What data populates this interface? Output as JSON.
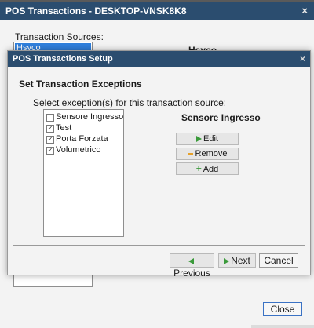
{
  "outer_window": {
    "title": "POS Transactions - DESKTOP-VNSK8K8",
    "close_glyph": "×",
    "sources_label": "Transaction Sources:",
    "sources": [
      "Hsyco"
    ],
    "selected_source_name": "Hsyco",
    "close_button": "Close"
  },
  "dialog": {
    "title": "POS Transactions Setup",
    "close_glyph": "×",
    "heading": "Set Transaction Exceptions",
    "prompt": "Select exception(s) for this transaction source:",
    "exceptions": [
      {
        "label": "Sensore Ingresso",
        "checked": false
      },
      {
        "label": "Test",
        "checked": true
      },
      {
        "label": "Porta Forzata",
        "checked": true
      },
      {
        "label": "Volumetrico",
        "checked": true
      }
    ],
    "selected_exception_name": "Sensore Ingresso",
    "buttons": {
      "edit": "Edit",
      "remove": "Remove",
      "add": "Add",
      "previous": "Previous",
      "next": "Next",
      "cancel": "Cancel"
    }
  },
  "colors": {
    "title_bar": "#2b4d6f",
    "selection": "#2f7fdc",
    "arrow_green": "#3a9a3a",
    "remove_orange": "#e6a12a"
  },
  "icons": [
    "arrow-right-icon",
    "minus-icon",
    "plus-icon",
    "arrow-left-icon",
    "close-icon"
  ]
}
